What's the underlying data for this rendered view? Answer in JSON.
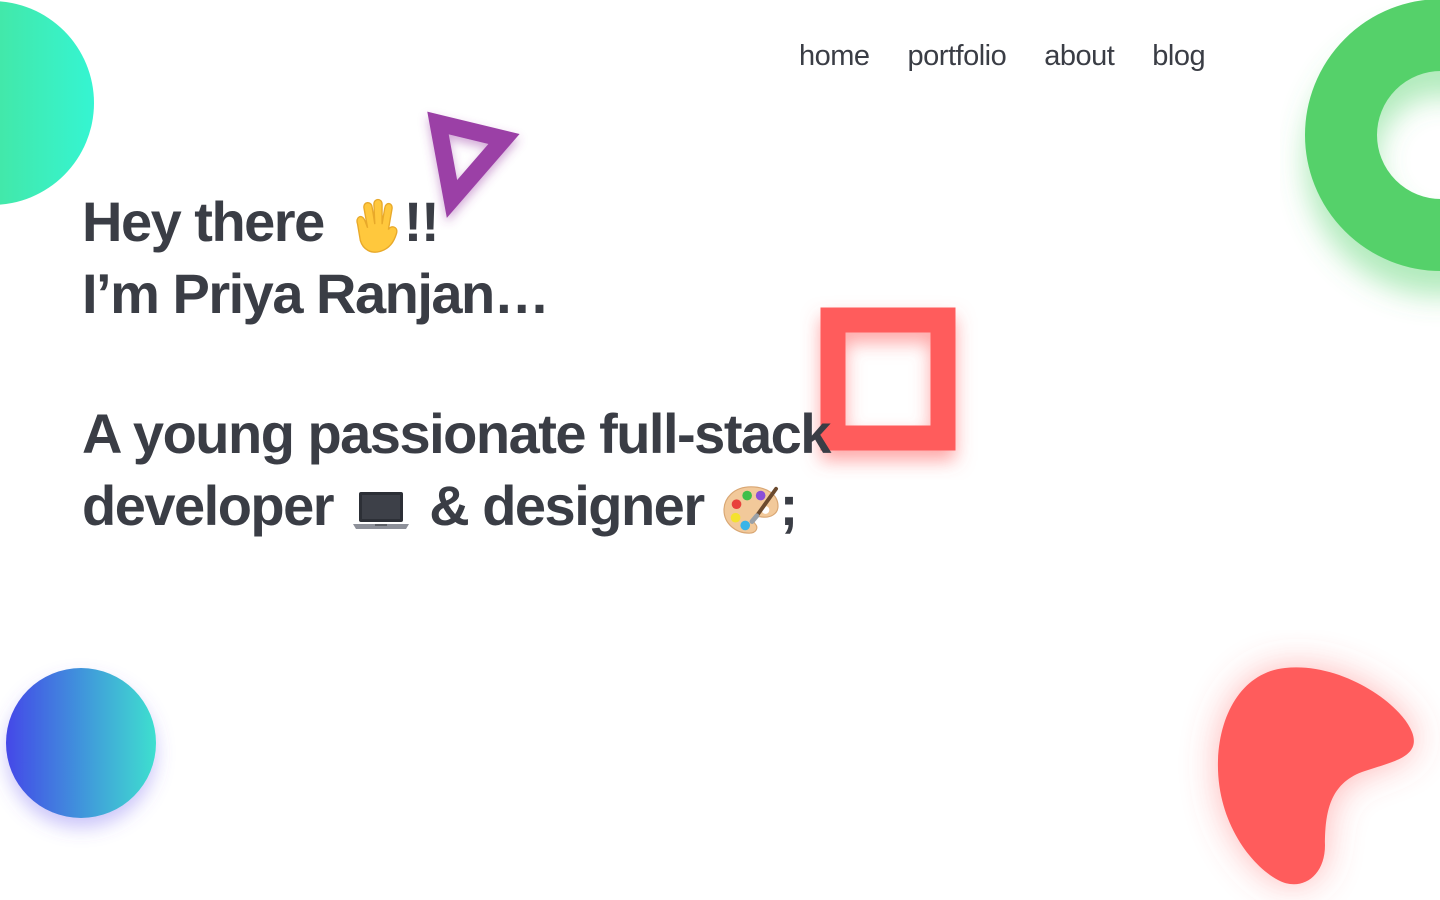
{
  "nav": {
    "items": [
      "home",
      "portfolio",
      "about",
      "blog"
    ]
  },
  "hero": {
    "greeting": "Hey there",
    "greeting_end": "!!",
    "name_line": "I’m Priya Ranjan…",
    "tagline_1": "A young passionate full-stack",
    "word_developer": "developer",
    "ampersand": "&",
    "word_designer": "designer",
    "end": ";"
  },
  "colors": {
    "text": "#3a3d45",
    "green": "#55d16a",
    "coral": "#ff5c5c",
    "purple": "#9b3fa6",
    "teal": "#3ee0cf",
    "blue": "#4448e8",
    "highlight_yellow": "#f5f511",
    "highlight_green": "#35d94f"
  }
}
